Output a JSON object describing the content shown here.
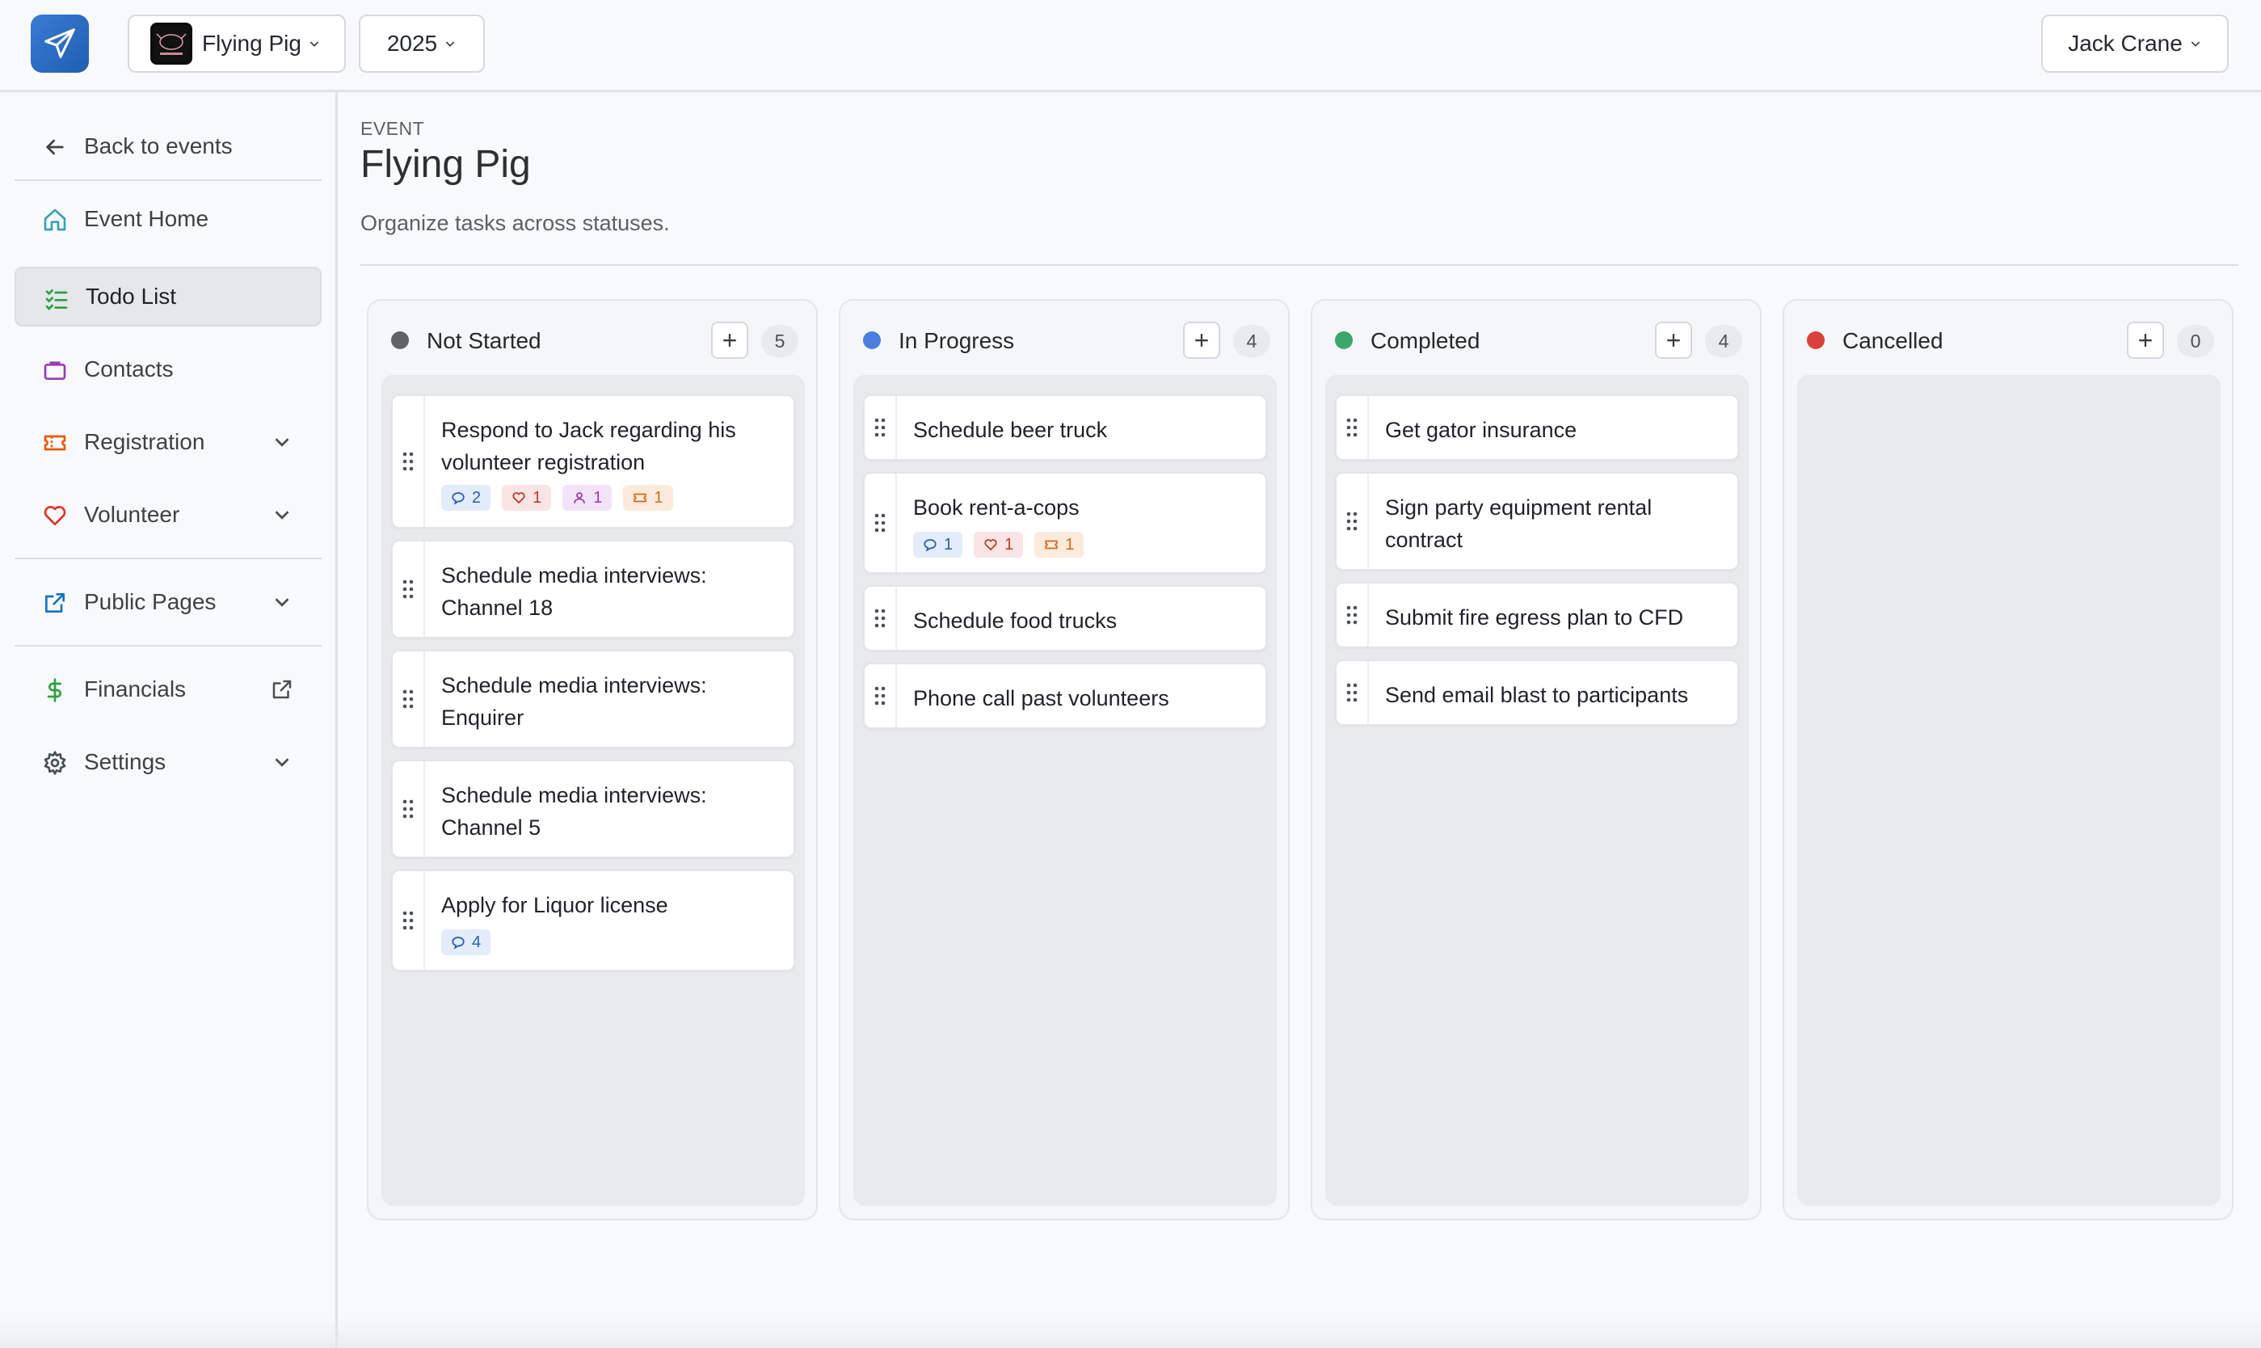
{
  "topbar": {
    "event_name": "Flying Pig",
    "year": "2025",
    "user_name": "Jack Crane"
  },
  "sidebar": {
    "back_label": "Back to events",
    "items": [
      {
        "label": "Event Home",
        "icon": "home-icon",
        "color": "#3aa0b8"
      },
      {
        "label": "Todo List",
        "icon": "checklist-icon",
        "color": "#2f9e44"
      },
      {
        "label": "Contacts",
        "icon": "briefcase-icon",
        "color": "#9b3bb5"
      },
      {
        "label": "Registration",
        "icon": "ticket-icon",
        "color": "#e8590c"
      },
      {
        "label": "Volunteer",
        "icon": "heart-icon",
        "color": "#e03131"
      },
      {
        "label": "Public Pages",
        "icon": "external-link-icon",
        "color": "#1971c2"
      },
      {
        "label": "Financials",
        "icon": "dollar-icon",
        "color": "#2f9e44"
      },
      {
        "label": "Settings",
        "icon": "gear-icon",
        "color": "#495057"
      }
    ]
  },
  "header": {
    "eyebrow": "EVENT",
    "title": "Flying Pig",
    "subtitle": "Organize tasks across statuses."
  },
  "columns": [
    {
      "title": "Not Started",
      "count": "5",
      "color": "#5f6368",
      "cards": [
        {
          "title": "Respond to Jack regarding his volunteer registration",
          "chips": {
            "comments": "2",
            "volunteer": "1",
            "contacts": "1",
            "registration": "1"
          }
        },
        {
          "title": "Schedule media interviews: Channel 18"
        },
        {
          "title": "Schedule media interviews: Enquirer"
        },
        {
          "title": "Schedule media interviews: Channel 5"
        },
        {
          "title": "Apply for Liquor license",
          "chips": {
            "comments": "4"
          }
        }
      ]
    },
    {
      "title": "In Progress",
      "count": "4",
      "color": "#4a7fe0",
      "cards": [
        {
          "title": "Schedule beer truck"
        },
        {
          "title": "Book rent-a-cops",
          "chips": {
            "comments": "1",
            "volunteer": "1",
            "registration": "1"
          }
        },
        {
          "title": "Schedule food trucks"
        },
        {
          "title": "Phone call past volunteers"
        }
      ]
    },
    {
      "title": "Completed",
      "count": "4",
      "color": "#3ca66b",
      "cards": [
        {
          "title": "Get gator insurance"
        },
        {
          "title": "Sign party equipment rental contract"
        },
        {
          "title": "Submit fire egress plan to CFD"
        },
        {
          "title": "Send email blast to participants"
        }
      ]
    },
    {
      "title": "Cancelled",
      "count": "0",
      "color": "#d9423a",
      "cards": []
    }
  ]
}
